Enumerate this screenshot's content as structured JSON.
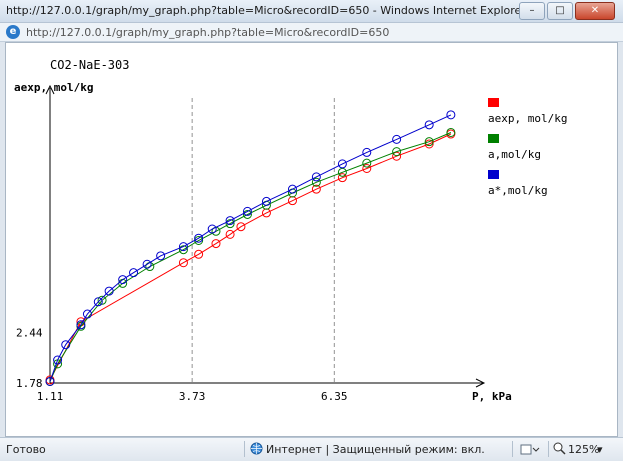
{
  "window": {
    "title": "http://127.0.0.1/graph/my_graph.php?table=Micro&recordID=650 - Windows Internet Explorer",
    "address": "http://127.0.0.1/graph/my_graph.php?table=Micro&recordID=650",
    "minimize_glyph": "–",
    "maximize_glyph": "□",
    "close_glyph": "✕",
    "ie_glyph": "e"
  },
  "status": {
    "ready": "Готово",
    "zone": "Интернет | Защищенный режим: вкл.",
    "zoom": "125%",
    "zoom_arrow": "▾",
    "zone_icon": "globe-icon",
    "lock_icon": "protected-mode-icon",
    "zoom_icon": "magnifier-icon"
  },
  "chart_data": {
    "type": "line",
    "title": "CO2-NaE-303",
    "xlabel": "P, kPa",
    "ylabel": "aexp, mol/kg",
    "x_ticks": [
      "1.11",
      "3.73",
      "6.35"
    ],
    "y_ticks": [
      "1.78",
      "2.44"
    ],
    "xlim": [
      1.11,
      9.0
    ],
    "ylim": [
      1.78,
      5.5
    ],
    "grid_x": [
      3.73,
      6.35
    ],
    "markers": "circle",
    "series": [
      {
        "name": "aexp, mol/kg",
        "color": "#ff0000",
        "x": [
          1.11,
          1.68,
          3.57,
          3.85,
          4.17,
          4.43,
          4.63,
          5.1,
          5.58,
          6.02,
          6.5,
          6.95,
          7.5,
          8.1,
          8.5
        ],
        "y": [
          1.82,
          2.58,
          3.35,
          3.46,
          3.6,
          3.72,
          3.82,
          4.0,
          4.16,
          4.31,
          4.46,
          4.58,
          4.74,
          4.9,
          5.03
        ]
      },
      {
        "name": "a,mol/kg",
        "color": "#008000",
        "x": [
          1.11,
          1.25,
          1.68,
          2.07,
          2.45,
          2.95,
          3.57,
          3.85,
          4.17,
          4.43,
          4.75,
          5.1,
          5.58,
          6.02,
          6.5,
          6.95,
          7.5,
          8.1,
          8.5
        ],
        "y": [
          1.8,
          2.03,
          2.52,
          2.86,
          3.08,
          3.3,
          3.52,
          3.64,
          3.76,
          3.86,
          3.98,
          4.1,
          4.26,
          4.4,
          4.53,
          4.65,
          4.8,
          4.93,
          5.05
        ]
      },
      {
        "name": "a*,mol/kg",
        "color": "#0000cc",
        "x": [
          1.11,
          1.25,
          1.4,
          1.68,
          1.8,
          2.0,
          2.2,
          2.45,
          2.65,
          2.9,
          3.15,
          3.57,
          3.85,
          4.1,
          4.43,
          4.75,
          5.1,
          5.58,
          6.02,
          6.5,
          6.95,
          7.5,
          8.1,
          8.5
        ],
        "y": [
          1.8,
          2.08,
          2.28,
          2.54,
          2.68,
          2.84,
          2.98,
          3.13,
          3.22,
          3.33,
          3.44,
          3.56,
          3.67,
          3.79,
          3.9,
          4.02,
          4.15,
          4.31,
          4.47,
          4.64,
          4.79,
          4.96,
          5.15,
          5.28
        ]
      }
    ],
    "legend_position": "right"
  }
}
